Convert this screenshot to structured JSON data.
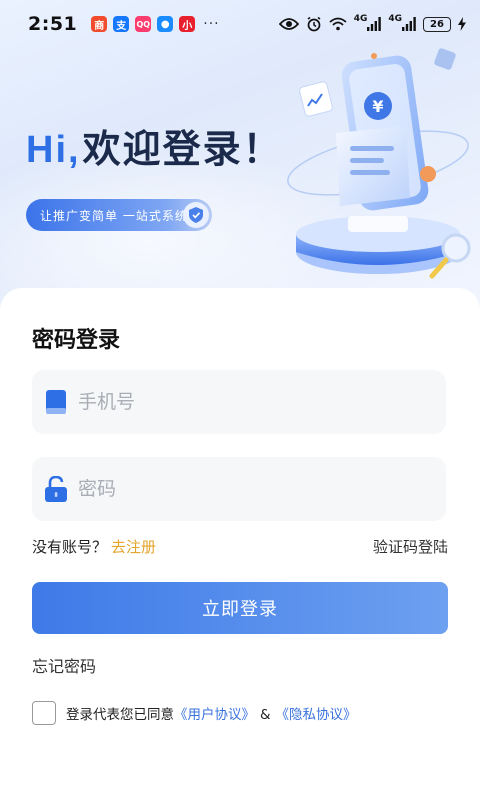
{
  "status_bar": {
    "time": "2:51",
    "battery": "26",
    "net_label_1": "4G",
    "net_label_2": "4G",
    "more": "···",
    "notif_icons": [
      {
        "name": "app-notification-icon-1",
        "color": "#f24b2e",
        "glyph": "商"
      },
      {
        "name": "alipay-notification-icon",
        "color": "#1677ff",
        "glyph": "支"
      },
      {
        "name": "app-notification-icon-3",
        "color": "#ff3c6e",
        "glyph": "QQ"
      },
      {
        "name": "app-notification-icon-4",
        "color": "#1a8cff",
        "glyph": "●"
      },
      {
        "name": "app-notification-icon-5",
        "color": "#e8202e",
        "glyph": "小"
      }
    ]
  },
  "hero": {
    "hi": "Hi,",
    "welcome": "欢迎登录！",
    "tagline": "让推广变简单 一站式系统",
    "currency_symbol": "¥"
  },
  "form": {
    "title": "密码登录",
    "phone_placeholder": "手机号",
    "password_placeholder": "密码",
    "no_account": "没有账号？",
    "register": "去注册",
    "sms_login": "验证码登陆",
    "login_button": "立即登录",
    "forgot_password": "忘记密码",
    "agreement_prefix": "登录代表您已同意",
    "user_agreement": "《用户协议》",
    "amp": "&",
    "privacy_policy": "《隐私协议》"
  },
  "colors": {
    "accent": "#3e7ae8",
    "register_link": "#e3a52e",
    "agreement_link": "#3a72dc"
  }
}
